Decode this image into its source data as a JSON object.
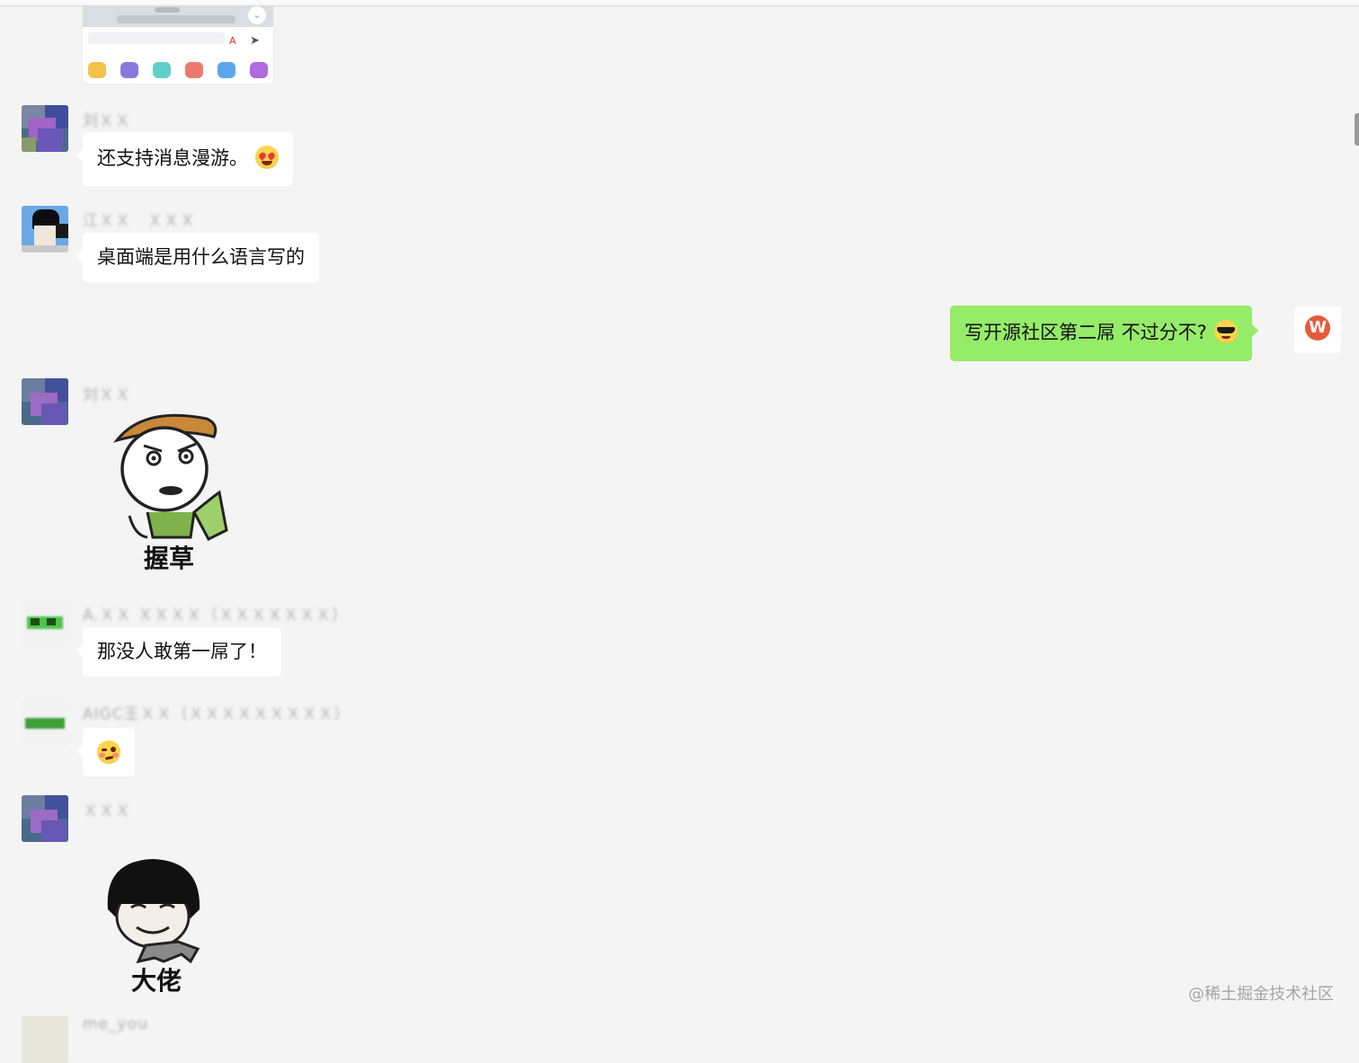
{
  "messages": [
    {
      "sender": "刘ＸＸ",
      "text": "还支持消息漫游。",
      "emoji": "heart-eyes-emoji"
    },
    {
      "sender": "江ＸＸ　ＸＸＸ",
      "text": "桌面端是用什么语言写的"
    },
    {
      "self": true,
      "text": "写开源社区第二屌 不过分不?",
      "emoji": "sunglasses-emoji"
    },
    {
      "sender": "刘ＸＸ",
      "sticker_caption": "握草"
    },
    {
      "sender": "A.ＸＸ ＸＸＸＸ（ＸＸＸＸＸＸＸ）",
      "text": "那没人敢第一屌了！"
    },
    {
      "sender": "AIGC王ＸＸ（ＸＸＸＸＸＸＸＸＸ）",
      "emoji": "woozy-face-emoji"
    },
    {
      "sender": "ＸＸＸ",
      "sticker_caption": "大佬"
    },
    {
      "sender": "me_you"
    }
  ],
  "watermark": "@稀土掘金技术社区",
  "colors": {
    "self_bubble": "#95ec69",
    "other_bubble": "#ffffff",
    "background": "#f4f4f4"
  }
}
